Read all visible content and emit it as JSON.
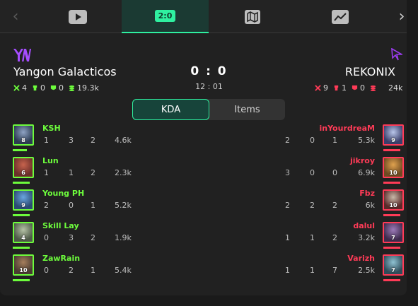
{
  "nav": {
    "tabs": [
      {
        "name": "play-icon",
        "active": false
      },
      {
        "name": "scoreboard",
        "label": "2:0",
        "active": true
      },
      {
        "name": "map-icon",
        "active": false
      },
      {
        "name": "chart-icon",
        "active": false
      }
    ]
  },
  "colors": {
    "radiant": "#6dfc3c",
    "dire": "#ff3b57",
    "accent": "#2ff0a0",
    "purple": "#a64dff"
  },
  "match": {
    "score": "0 : 0",
    "time": "12 : 01",
    "left": {
      "name": "Yangon Galacticos",
      "kills": "4",
      "towers": "0",
      "barracks": "0",
      "gold": "19.3k"
    },
    "right": {
      "name": "REKONIX",
      "kills": "9",
      "towers": "1",
      "barracks": "0",
      "gold": "24k"
    }
  },
  "toggle": {
    "kda": "KDA",
    "items": "Items"
  },
  "left_players": [
    {
      "name": "KSH",
      "level": "8",
      "k": "1",
      "d": "3",
      "a": "2",
      "nw": "4.6k",
      "hp": 0.85
    },
    {
      "name": "Lun",
      "level": "6",
      "k": "1",
      "d": "1",
      "a": "2",
      "nw": "2.3k",
      "hp": 1
    },
    {
      "name": "Young PH",
      "level": "9",
      "k": "2",
      "d": "0",
      "a": "1",
      "nw": "5.2k",
      "hp": 1
    },
    {
      "name": "Skill Lay",
      "level": "4",
      "k": "0",
      "d": "3",
      "a": "2",
      "nw": "1.9k",
      "hp": 1
    },
    {
      "name": "ZawRain",
      "level": "10",
      "k": "0",
      "d": "2",
      "a": "1",
      "nw": "5.4k",
      "hp": 1
    }
  ],
  "right_players": [
    {
      "name": "inYourdreaM",
      "level": "9",
      "k": "2",
      "d": "0",
      "a": "1",
      "nw": "5.3k",
      "hp": 1
    },
    {
      "name": "jikroy",
      "level": "10",
      "k": "3",
      "d": "0",
      "a": "0",
      "nw": "6.9k",
      "hp": 1
    },
    {
      "name": "Fbz",
      "level": "10",
      "k": "2",
      "d": "2",
      "a": "2",
      "nw": "6k",
      "hp": 1
    },
    {
      "name": "dalul",
      "level": "7",
      "k": "1",
      "d": "1",
      "a": "2",
      "nw": "3.2k",
      "hp": 1
    },
    {
      "name": "Varizh",
      "level": "7",
      "k": "1",
      "d": "1",
      "a": "7",
      "nw": "2.5k",
      "hp": 1
    }
  ]
}
